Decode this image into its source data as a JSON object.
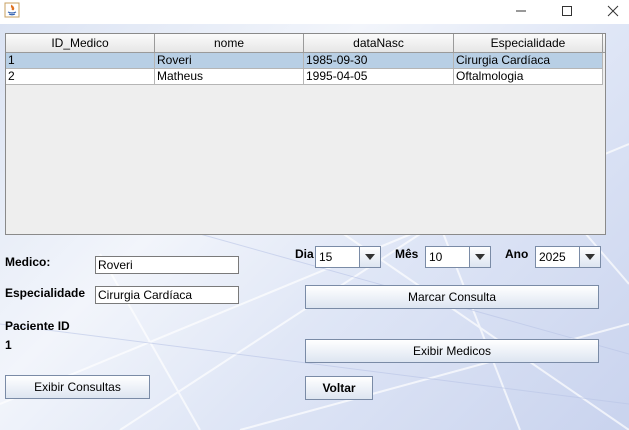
{
  "window": {
    "controls": [
      "minimize-icon",
      "maximize-icon",
      "close-icon"
    ]
  },
  "table": {
    "columns": [
      "ID_Medico",
      "nome",
      "dataNasc",
      "Especialidade"
    ],
    "rows": [
      [
        "1",
        "Roveri",
        "1985-09-30",
        "Cirurgia Cardíaca"
      ],
      [
        "2",
        "Matheus",
        "1995-04-05",
        "Oftalmologia"
      ]
    ],
    "selected_row": 0
  },
  "form": {
    "medico_label": "Medico:",
    "medico_value": "Roveri",
    "especialidade_label": "Especialidade",
    "especialidade_value": "Cirurgia Cardíaca",
    "paciente_label": "Paciente ID",
    "paciente_value": "1",
    "dia_label": "Dia",
    "dia_value": "15",
    "mes_label": "Mês",
    "mes_value": "10",
    "ano_label": "Ano",
    "ano_value": "2025"
  },
  "buttons": {
    "marcar": "Marcar Consulta",
    "exibir_medicos": "Exibir Medicos",
    "exibir_consultas": "Exibir Consultas",
    "voltar": "Voltar"
  }
}
